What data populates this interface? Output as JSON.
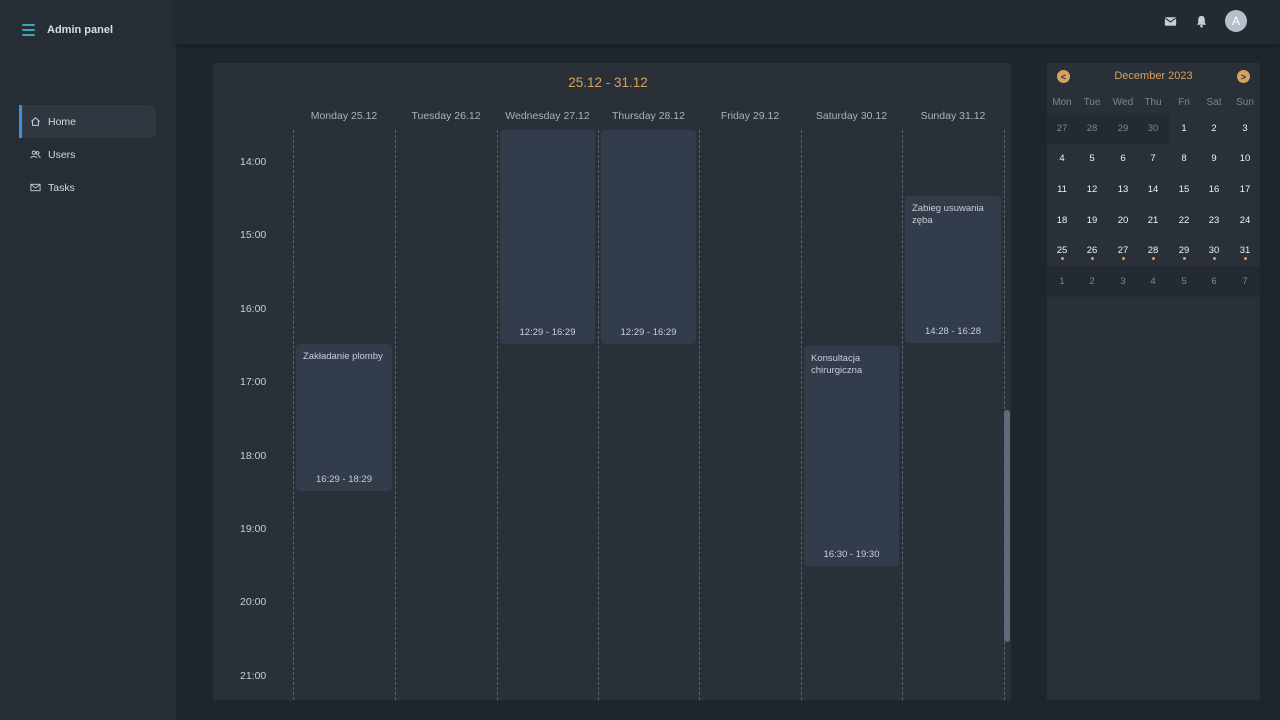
{
  "app": {
    "title": "Admin panel"
  },
  "sidebar": {
    "items": [
      {
        "label": "Home",
        "icon": "home-icon",
        "active": true
      },
      {
        "label": "Users",
        "icon": "users-icon",
        "active": false
      },
      {
        "label": "Tasks",
        "icon": "mail-icon",
        "active": false
      }
    ]
  },
  "topbar": {
    "icons": [
      "mail-icon",
      "bell-icon"
    ],
    "avatar": "A"
  },
  "week": {
    "title": "25.12 - 31.12",
    "days": [
      "Monday 25.12",
      "Tuesday 26.12",
      "Wednesday 27.12",
      "Thursday 28.12",
      "Friday 29.12",
      "Saturday 30.12",
      "Sunday 31.12"
    ],
    "hours": [
      "14:00",
      "15:00",
      "16:00",
      "17:00",
      "18:00",
      "19:00",
      "20:00",
      "21:00"
    ],
    "events": [
      {
        "day": 0,
        "title": "Zakładanie plomby",
        "time": "16:29 - 18:29"
      },
      {
        "day": 2,
        "title": "",
        "time": "12:29 - 16:29"
      },
      {
        "day": 3,
        "title": "",
        "time": "12:29 - 16:29"
      },
      {
        "day": 5,
        "title": "Konsultacja chirurgiczna",
        "time": "16:30 - 19:30"
      },
      {
        "day": 6,
        "title": "Zabieg usuwania zęba",
        "time": "14:28 - 16:28"
      }
    ]
  },
  "mini_calendar": {
    "month_label": "December 2023",
    "prev": "<",
    "next": ">",
    "weekdays": [
      "Mon",
      "Tue",
      "Wed",
      "Thu",
      "Fri",
      "Sat",
      "Sun"
    ],
    "weeks": [
      [
        "27",
        "28",
        "29",
        "30",
        "1",
        "2",
        "3"
      ],
      [
        "4",
        "5",
        "6",
        "7",
        "8",
        "9",
        "10"
      ],
      [
        "11",
        "12",
        "13",
        "14",
        "15",
        "16",
        "17"
      ],
      [
        "18",
        "19",
        "20",
        "21",
        "22",
        "23",
        "24"
      ],
      [
        "25",
        "26",
        "27",
        "28",
        "29",
        "30",
        "31"
      ],
      [
        "1",
        "2",
        "3",
        "4",
        "5",
        "6",
        "7"
      ]
    ],
    "event_days": [
      "25",
      "26",
      "27",
      "28",
      "29",
      "30",
      "31"
    ]
  },
  "colors": {
    "accent": "#d6a25f",
    "active_bar": "#3b8fe0",
    "menu_icon": "#3fa4b8",
    "event_bg": "#323c4a"
  }
}
